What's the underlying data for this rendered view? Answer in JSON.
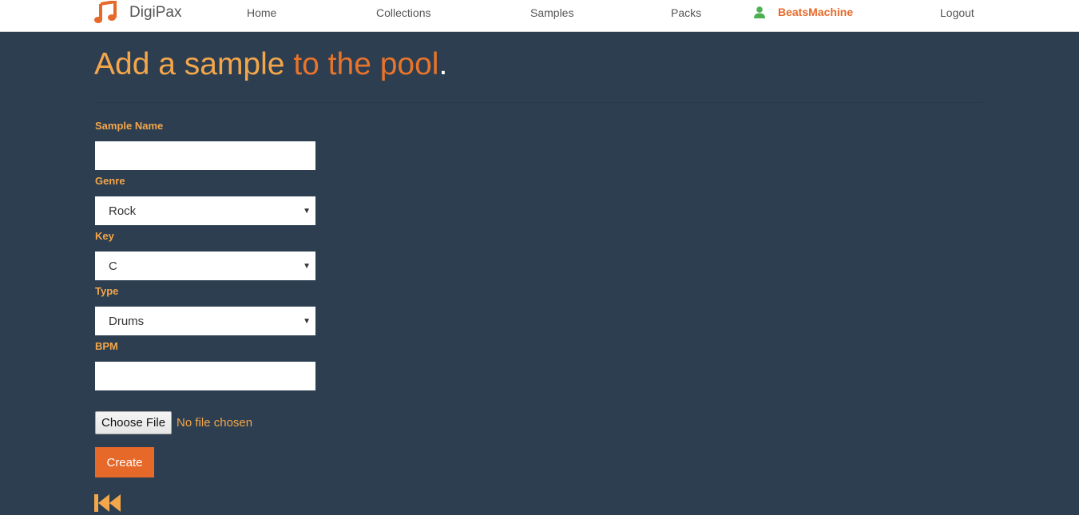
{
  "nav": {
    "brand": "DigiPax",
    "links": {
      "home": "Home",
      "collections": "Collections",
      "samples": "Samples",
      "packs": "Packs"
    },
    "user": "BeatsMachine",
    "logout": "Logout"
  },
  "page": {
    "title_part1": "Add a sample",
    "title_part2": " to the pool",
    "title_part3": "."
  },
  "form": {
    "sample_name_label": "Sample Name",
    "sample_name_value": "",
    "genre_label": "Genre",
    "genre_value": "Rock",
    "key_label": "Key",
    "key_value": "C",
    "type_label": "Type",
    "type_value": "Drums",
    "bpm_label": "BPM",
    "bpm_value": "",
    "file_button": "Choose File",
    "file_status": "No file chosen",
    "submit": "Create"
  },
  "icons": {
    "brand": "music-note-icon",
    "user": "user-icon",
    "back": "fast-backward-icon"
  },
  "colors": {
    "background": "#2c3e50",
    "accent": "#e6692a",
    "label": "#f4a64a",
    "user_icon": "#4caf50"
  }
}
